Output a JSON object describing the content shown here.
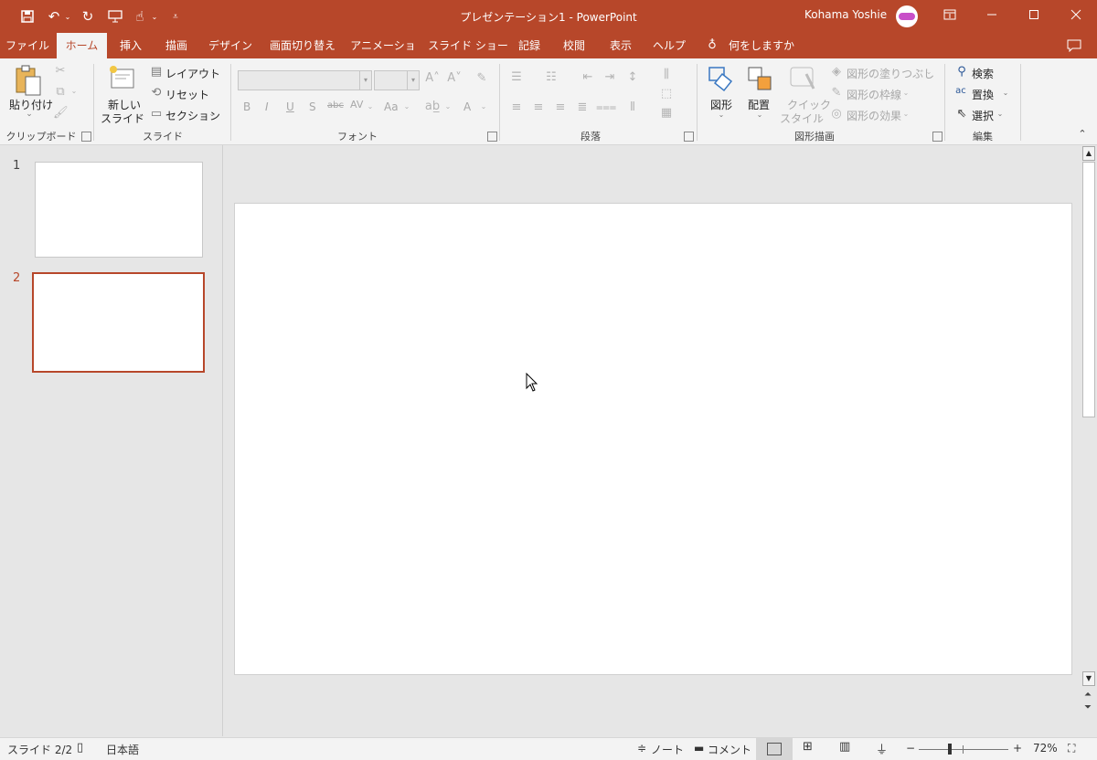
{
  "window": {
    "title": "プレゼンテーション1  -  PowerPoint",
    "user": "Kohama Yoshie",
    "accent_color": "#b7472a"
  },
  "qat_icons": [
    "save-icon",
    "undo-icon",
    "redo-icon",
    "present-icon",
    "touch-mode-icon",
    "customize-qat-icon"
  ],
  "tabs": [
    {
      "label": "ファイル"
    },
    {
      "label": "ホーム",
      "active": true
    },
    {
      "label": "挿入"
    },
    {
      "label": "描画"
    },
    {
      "label": "デザイン"
    },
    {
      "label": "画面切り替え"
    },
    {
      "label": "アニメーション"
    },
    {
      "label": "スライド ショー"
    },
    {
      "label": "記録"
    },
    {
      "label": "校閲"
    },
    {
      "label": "表示"
    },
    {
      "label": "ヘルプ"
    }
  ],
  "tell_me": "何をしますか",
  "ribbon": {
    "clipboard": {
      "paste": "貼り付け",
      "group": "クリップボード"
    },
    "slides": {
      "new_slide_1": "新しい",
      "new_slide_2": "スライド",
      "layout": "レイアウト",
      "reset": "リセット",
      "section": "セクション",
      "group": "スライド"
    },
    "font": {
      "group": "フォント",
      "bold": "B",
      "italic": "I",
      "underline": "U",
      "shadow": "S",
      "strike": "abc",
      "spacing": "AV",
      "case": "Aa",
      "color": "A"
    },
    "paragraph": {
      "group": "段落"
    },
    "drawing": {
      "shapes": "図形",
      "arrange": "配置",
      "quick_style_1": "クイック",
      "quick_style_2": "スタイル",
      "fill": "図形の塗りつぶし",
      "outline": "図形の枠線",
      "effects": "図形の効果",
      "group": "図形描画"
    },
    "editing": {
      "find": "検索",
      "replace": "置換",
      "select": "選択",
      "group": "編集"
    }
  },
  "slides": [
    {
      "number": "1"
    },
    {
      "number": "2",
      "selected": true
    }
  ],
  "status": {
    "slide_count": "スライド 2/2",
    "language": "日本語",
    "notes": "ノート",
    "comments": "コメント",
    "zoom": "72%",
    "zoom_level": 0.72
  }
}
